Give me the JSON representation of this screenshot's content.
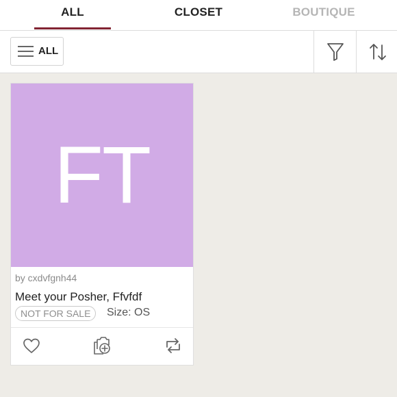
{
  "tabs": [
    {
      "label": "ALL",
      "active": true
    },
    {
      "label": "CLOSET",
      "active": false
    },
    {
      "label": "BOUTIQUE",
      "active": false
    }
  ],
  "toolbar": {
    "all_label": "ALL",
    "icons": [
      "menu-icon",
      "filter-icon",
      "sort-icon"
    ]
  },
  "listing": {
    "initials": "FT",
    "image_color": "#d1abe6",
    "by_line": "by cxdvfgnh44",
    "title": "Meet your Posher, Ffvfdf",
    "badge": "NOT FOR SALE",
    "size": "Size: OS",
    "actions": [
      "like-icon",
      "add-to-bundle-icon",
      "share-icon"
    ]
  },
  "colors": {
    "accent": "#822432",
    "background": "#eeece7"
  }
}
